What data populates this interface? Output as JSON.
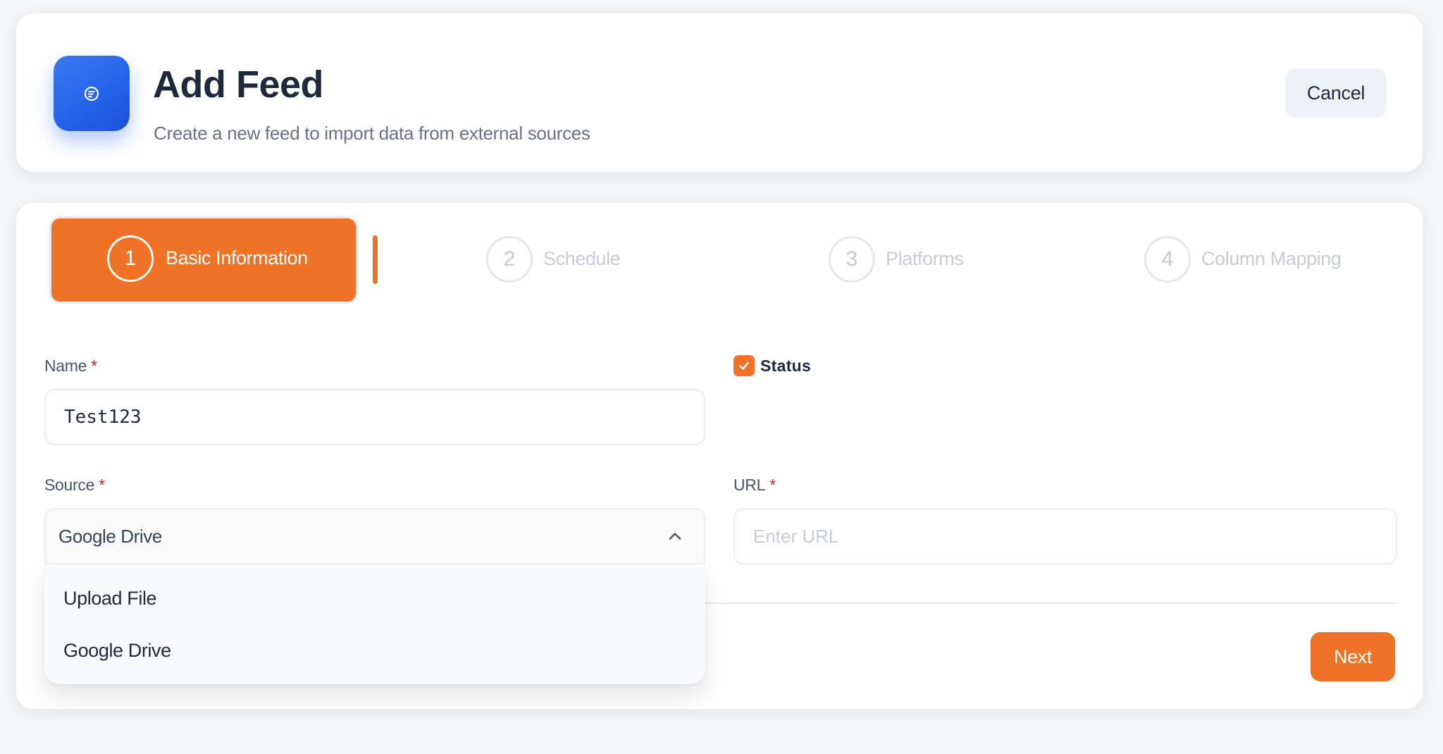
{
  "header": {
    "title": "Add Feed",
    "subtitle": "Create a new feed to import data from external sources",
    "cancel_label": "Cancel",
    "logo_icon": "feed-icon"
  },
  "steps": [
    {
      "number": "1",
      "label": "Basic Information",
      "active": true
    },
    {
      "number": "2",
      "label": "Schedule",
      "active": false
    },
    {
      "number": "3",
      "label": "Platforms",
      "active": false
    },
    {
      "number": "4",
      "label": "Column Mapping",
      "active": false
    }
  ],
  "form": {
    "name_label": "Name",
    "name_value": "Test123",
    "required_mark": "*",
    "status_label": "Status",
    "status_checked": true,
    "source_label": "Source",
    "source_value": "Google Drive",
    "source_options": [
      "Upload File",
      "Google Drive"
    ],
    "url_label": "URL",
    "url_placeholder": "Enter URL"
  },
  "footer": {
    "next_label": "Next"
  },
  "colors": {
    "accent": "#f07226",
    "logo": "#2563eb",
    "required": "#c81e3a"
  }
}
